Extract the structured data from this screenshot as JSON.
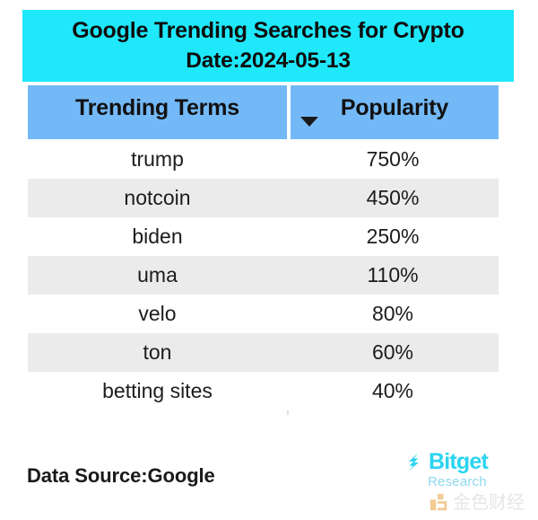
{
  "banner": {
    "title": "Google Trending Searches for Crypto",
    "date_line": "Date:2024-05-13",
    "background_color": "#1fe8fb"
  },
  "table": {
    "header_color": "#74b9f7",
    "stripe_color": "#ebebeb",
    "columns": [
      {
        "label": "Trending Terms",
        "sort_indicator": "none"
      },
      {
        "label": "Popularity",
        "sort_indicator": "descending"
      }
    ],
    "rows": [
      {
        "term": "trump",
        "popularity": "750%"
      },
      {
        "term": "notcoin",
        "popularity": "450%"
      },
      {
        "term": "biden",
        "popularity": "250%"
      },
      {
        "term": "uma",
        "popularity": "110%"
      },
      {
        "term": "velo",
        "popularity": "80%"
      },
      {
        "term": "ton",
        "popularity": "60%"
      },
      {
        "term": "betting sites",
        "popularity": "40%"
      }
    ]
  },
  "footer": {
    "data_source": "Data Source:Google",
    "brand_name": "Bitget",
    "brand_sub": "Research",
    "brand_color": "#2ad4f0",
    "watermark_text": "金色财经",
    "watermark_color": "#d1d1d1"
  },
  "chart_data": {
    "type": "table",
    "title": "Google Trending Searches for Crypto",
    "subtitle": "Date:2024-05-13",
    "columns": [
      "Trending Terms",
      "Popularity"
    ],
    "categories": [
      "trump",
      "notcoin",
      "biden",
      "uma",
      "velo",
      "ton",
      "betting sites"
    ],
    "values": [
      750,
      450,
      250,
      110,
      80,
      60,
      40
    ],
    "value_unit": "%",
    "sorted_by": "Popularity",
    "sort_order": "descending",
    "xlabel": "Trending Terms",
    "ylabel": "Popularity",
    "source": "Google"
  }
}
